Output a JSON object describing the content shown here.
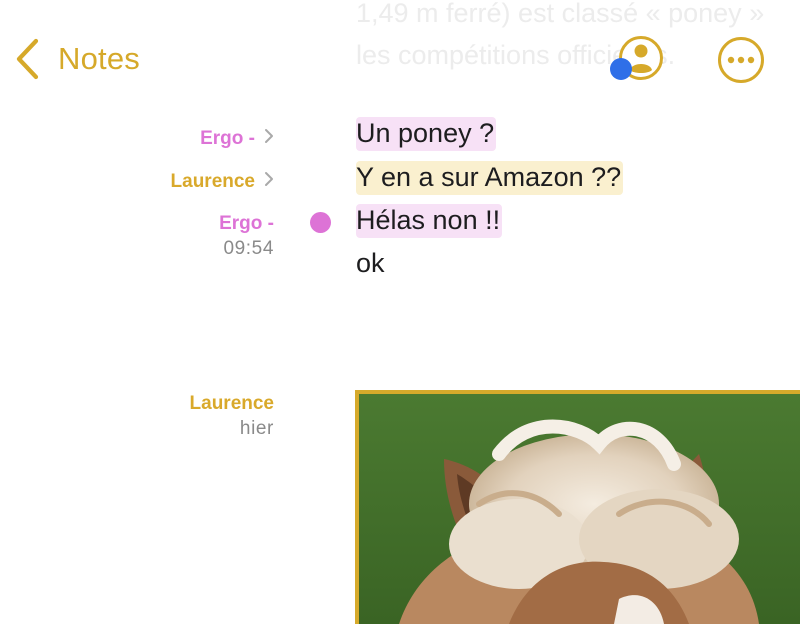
{
  "background_text": {
    "line1": "1,49 m ferré) est classé « poney »",
    "line2": "les compétitions officielles."
  },
  "nav": {
    "back_label": "Notes"
  },
  "entries": [
    {
      "author": "Ergo -",
      "time": "",
      "text": "Un poney ?",
      "highlight": "#f7e1f6"
    },
    {
      "author": "Laurence",
      "time": "",
      "text": "Y en a sur Amazon ??",
      "highlight": "#faf0cf"
    },
    {
      "author": "Ergo -",
      "time": "09:54",
      "text": "Hélas non !!",
      "highlight": "#f7e1f6"
    },
    {
      "author": "",
      "time": "",
      "text": "ok",
      "highlight": ""
    }
  ],
  "attachment": {
    "author": "Laurence",
    "time": "hier"
  },
  "colors": {
    "accent": "#d6a92a",
    "ergo": "#dd73d6",
    "laurence": "#d9a92b",
    "collab_dot": "#2f6fe8"
  },
  "icons": {
    "back": "chevron-left-icon",
    "collab": "person-circle-icon",
    "more": "ellipsis-circle-icon",
    "author_link": "chevron-right-icon"
  }
}
